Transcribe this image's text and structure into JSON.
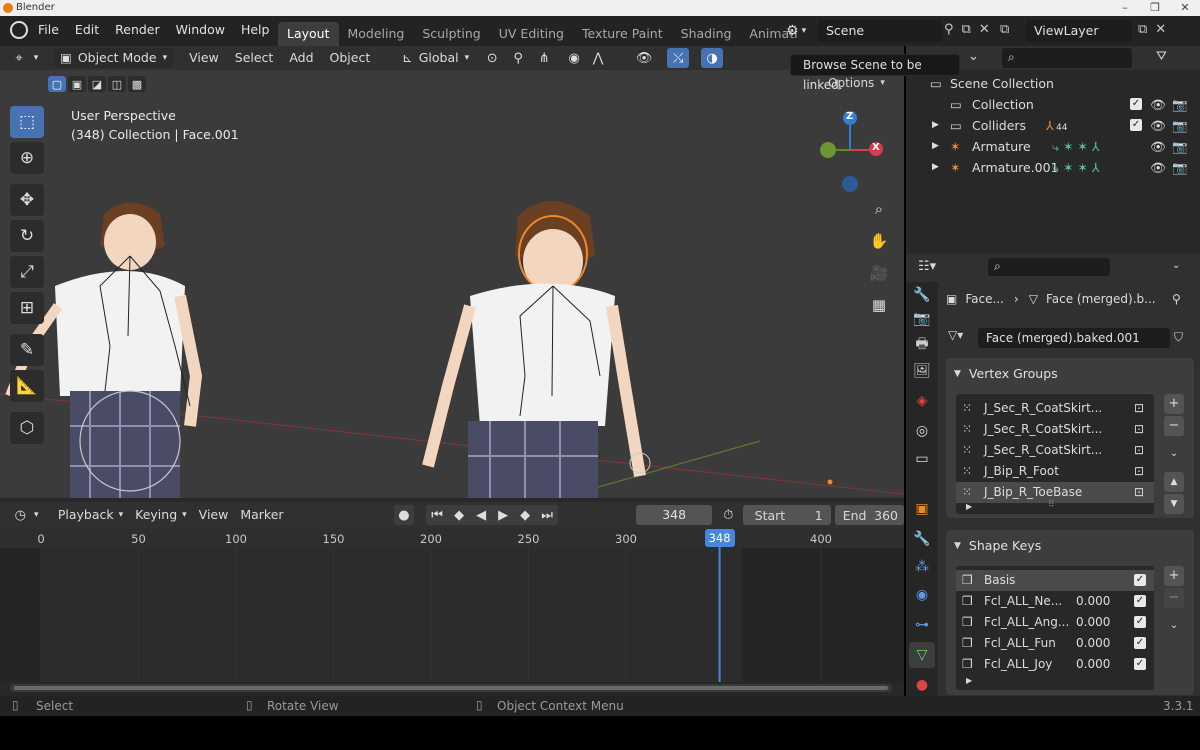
{
  "window": {
    "title": "Blender"
  },
  "menu": [
    "File",
    "Edit",
    "Render",
    "Window",
    "Help"
  ],
  "workspace_tabs": [
    "Layout",
    "Modeling",
    "Sculpting",
    "UV Editing",
    "Texture Paint",
    "Shading",
    "Animati"
  ],
  "active_workspace": "Layout",
  "scene_name": "Scene",
  "view_layer": "ViewLayer",
  "tooltip": "Browse Scene to be linked.",
  "viewport": {
    "mode": "Object Mode",
    "menus": [
      "View",
      "Select",
      "Add",
      "Object"
    ],
    "orientation": "Global",
    "options_label": "Options",
    "info_line1": "User Perspective",
    "info_line2": "(348) Collection | Face.001",
    "gizmo": {
      "z": "Z",
      "x": "X"
    }
  },
  "outliner": {
    "rows": [
      {
        "label": "Scene Collection"
      },
      {
        "label": "Collection"
      },
      {
        "label": "Colliders",
        "badge": "44"
      },
      {
        "label": "Armature"
      },
      {
        "label": "Armature.001"
      }
    ]
  },
  "properties": {
    "breadcrumb_obj": "Face...",
    "breadcrumb_mesh": "Face (merged).b...",
    "mesh_name": "Face (merged).baked.001",
    "vertex_groups_title": "Vertex Groups",
    "vertex_groups": [
      "J_Sec_R_CoatSkirt...",
      "J_Sec_R_CoatSkirt...",
      "J_Sec_R_CoatSkirt...",
      "J_Bip_R_Foot",
      "J_Bip_R_ToeBase"
    ],
    "shape_keys_title": "Shape Keys",
    "shape_keys": [
      {
        "name": "Basis",
        "value": ""
      },
      {
        "name": "Fcl_ALL_Ne...",
        "value": "0.000"
      },
      {
        "name": "Fcl_ALL_Ang...",
        "value": "0.000"
      },
      {
        "name": "Fcl_ALL_Fun",
        "value": "0.000"
      },
      {
        "name": "Fcl_ALL_Joy",
        "value": "0.000"
      }
    ]
  },
  "timeline": {
    "menus": [
      "Playback",
      "Keying",
      "View",
      "Marker"
    ],
    "current_frame": "348",
    "start_label": "Start",
    "start": "1",
    "end_label": "End",
    "end": "360",
    "ticks": [
      "0",
      "50",
      "100",
      "150",
      "200",
      "250",
      "300",
      "400"
    ],
    "playhead_label": "348"
  },
  "status": {
    "select": "Select",
    "rotate": "Rotate View",
    "context": "Object Context Menu",
    "version": "3.3.1"
  }
}
